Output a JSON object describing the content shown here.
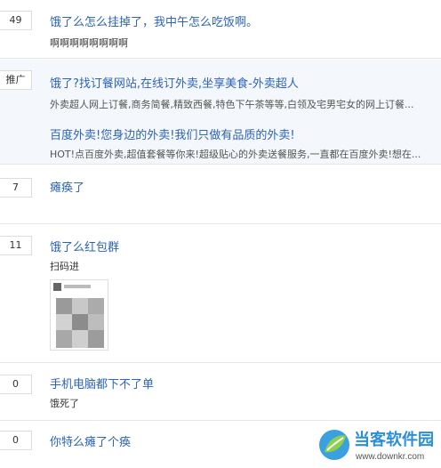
{
  "posts": [
    {
      "count": "49",
      "title": "饿了么怎么挂掉了，我中午怎么吃饭啊。",
      "snippet": "啊啊啊啊啊啊啊啊"
    },
    {
      "count": "7",
      "title": "瘫痪了",
      "snippet": ""
    },
    {
      "count": "11",
      "title": "饿了么红包群",
      "snippet": "扫码进"
    },
    {
      "count": "0",
      "title": "手机电脑都下不了单",
      "snippet": "饿死了"
    },
    {
      "count": "0",
      "title": "你特么瘫了个痪",
      "snippet": ""
    }
  ],
  "promo": {
    "badge": "推广",
    "ads": [
      {
        "title": "饿了?找订餐网站,在线订外卖,坐享美食-外卖超人",
        "snippet": "外卖超人网上订餐,商务简餐,精致西餐,特色下午茶等等,白领及宅男宅女的网上订餐..."
      },
      {
        "title": "百度外卖!您身边的外卖!我们只做有品质的外卖!",
        "snippet": "HOT!点百度外卖,超值套餐等你来!超级贴心的外卖送餐服务,一直都在百度外卖!想在..."
      }
    ]
  },
  "qr_image": {
    "icon": "qr-code-image"
  },
  "watermark": {
    "name": "当客软件园",
    "url": "www.downkr.com",
    "logo_icon": "leaf-logo-icon"
  },
  "colors": {
    "link": "#2d64b3",
    "promo_bg": "#f4f7fb",
    "watermark": "#2a8fd6"
  }
}
